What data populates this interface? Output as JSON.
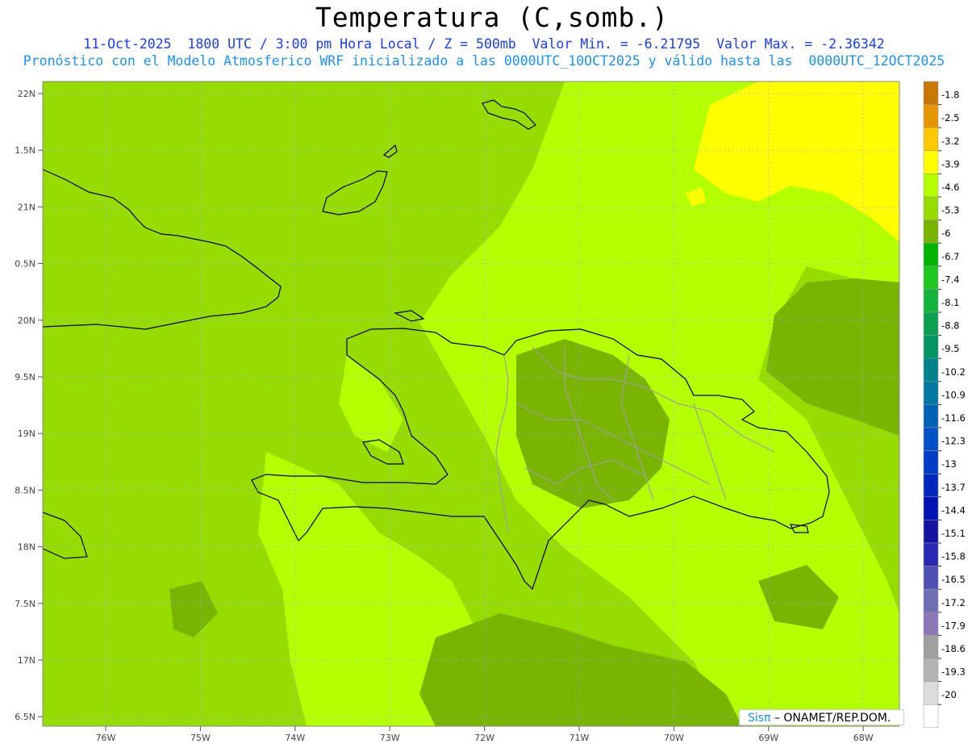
{
  "title": "Temperatura (C,somb.)",
  "subtitle_line1": "11-Oct-2025  1800 UTC / 3:00 pm Hora Local / Z = 500mb  Valor Min. = -6.21795  Valor Max. = -2.36342",
  "subtitle_line2": "Pronóstico con el Modelo Atmosferico WRF inicializado a las 0000UTC_10OCT2025 y válido hasta las  0000UTC_12OCT2025",
  "lat_labels": [
    "22N",
    "1.5N",
    "21N",
    "0.5N",
    "20N",
    "9.5N",
    "19N",
    "8.5N",
    "18N",
    "7.5N",
    "17N",
    "6.5N"
  ],
  "lon_labels": [
    "76W",
    "75W",
    "74W",
    "73W",
    "72W",
    "71W",
    "70W",
    "69W",
    "68W"
  ],
  "colorbar": {
    "labels": [
      "-1.8",
      "-2.5",
      "-3.2",
      "-3.9",
      "-4.6",
      "-5.3",
      "-6",
      "-6.7",
      "-7.4",
      "-8.1",
      "-8.8",
      "-9.5",
      "-10.2",
      "-10.9",
      "-11.6",
      "-12.3",
      "-13",
      "-13.7",
      "-14.4",
      "-15.1",
      "-15.8",
      "-16.5",
      "-17.2",
      "-17.9",
      "-18.6",
      "-19.3",
      "-20"
    ],
    "colors": [
      "#c87800",
      "#e69600",
      "#ffc800",
      "#ffff00",
      "#b4ff00",
      "#96dc00",
      "#78b400",
      "#00b400",
      "#1ec81e",
      "#14b43c",
      "#0aa050",
      "#009664",
      "#00828c",
      "#0078a0",
      "#0064b4",
      "#0050c8",
      "#003cc8",
      "#0028be",
      "#0014b4",
      "#1414a0",
      "#2828b4",
      "#5050b4",
      "#6e6eb4",
      "#8c78b4",
      "#a0a0a0",
      "#b4b4b4",
      "#dcdcdc",
      "#ffffff"
    ]
  },
  "colors": {
    "field_base": "#96dc00",
    "field_light": "#b4ff00",
    "field_dark": "#78b400",
    "field_warm": "#ffff00",
    "coastline": "#000000",
    "border": "#a0a0a0",
    "grid": "#a0a0ff"
  },
  "credit": {
    "brand": "Sisπ",
    "text": "– ONAMET/REP.DOM."
  }
}
